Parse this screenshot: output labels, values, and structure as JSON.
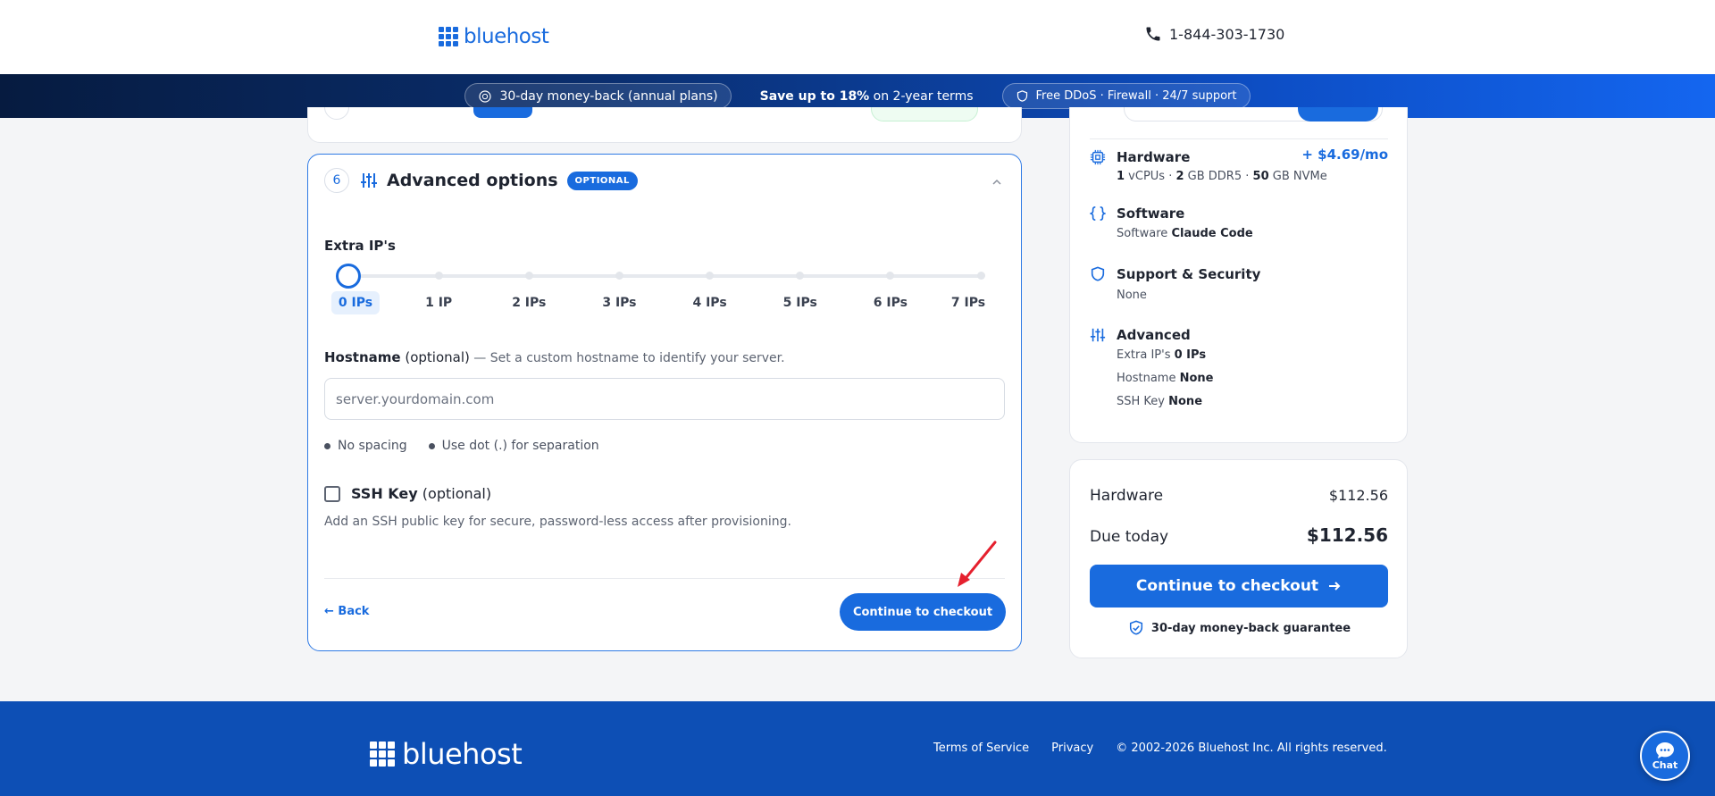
{
  "header": {
    "logo_text": "bluehost",
    "phone": "1-844-303-1730"
  },
  "banner": {
    "money_back": "30-day money-back (annual plans)",
    "save_bold": "Save up to 18%",
    "save_rest": " on 2-year terms",
    "ddos": "Free DDoS · Firewall · 24/7 support"
  },
  "advanced": {
    "step_number": "6",
    "title": "Advanced options",
    "badge": "OPTIONAL",
    "extra_ips_label": "Extra IP's",
    "ip_options": [
      "0 IPs",
      "1 IP",
      "2 IPs",
      "3 IPs",
      "4 IPs",
      "5 IPs",
      "6 IPs",
      "7 IPs"
    ],
    "selected_ip_index": 0,
    "hostname_label": "Hostname",
    "hostname_optional": "(optional)",
    "hostname_hint": " — Set a custom hostname to identify your server.",
    "hostname_value": "",
    "hostname_placeholder": "server.yourdomain.com",
    "rule_1": "No spacing",
    "rule_2": "Use dot (.) for separation",
    "ssh_label": "SSH Key",
    "ssh_optional": "(optional)",
    "ssh_checked": false,
    "ssh_desc": "Add an SSH public key for secure, password-less access after provisioning.",
    "back": "← Back",
    "continue": "Continue to checkout"
  },
  "summary": {
    "hardware": {
      "title": "Hardware",
      "price": "+ $4.69/mo",
      "vcpu_num": "1",
      "vcpu_unit": " vCPUs",
      "sep": " · ",
      "ram_num": "2",
      "ram_unit": " GB DDR5",
      "disk_num": "50",
      "disk_unit": " GB NVMe"
    },
    "software": {
      "title": "Software",
      "prefix": "Software ",
      "value": "Claude Code"
    },
    "support": {
      "title": "Support & Security",
      "value": "None"
    },
    "advanced": {
      "title": "Advanced",
      "extra_ips_prefix": "Extra IP's ",
      "extra_ips_value": "0 IPs",
      "hostname_prefix": "Hostname ",
      "hostname_value": "None",
      "ssh_prefix": "SSH Key ",
      "ssh_value": "None"
    }
  },
  "totals": {
    "hardware_label": "Hardware",
    "hardware_value": "$112.56",
    "due_label": "Due today",
    "due_value": "$112.56",
    "continue": "Continue to checkout",
    "guarantee": "30-day money-back guarantee"
  },
  "footer": {
    "logo_text": "bluehost",
    "terms": "Terms of Service",
    "privacy": "Privacy",
    "copyright": "© 2002-2026 Bluehost Inc. All rights reserved.",
    "chat": "Chat"
  },
  "colors": {
    "brand_blue": "#196bde",
    "footer_blue": "#0d4fb5",
    "annotation_red": "#e5202e"
  }
}
